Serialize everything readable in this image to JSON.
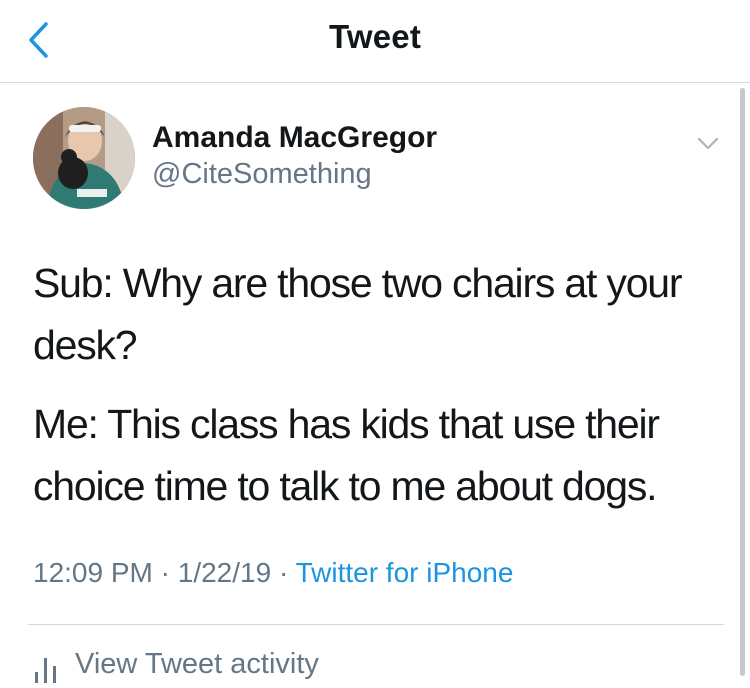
{
  "nav": {
    "title": "Tweet"
  },
  "tweet": {
    "author": {
      "name": "Amanda MacGregor",
      "handle": "@CiteSomething"
    },
    "paragraphs": [
      "Sub: Why are those two chairs at your desk?",
      "Me: This class has kids that use their choice time to talk to me about dogs."
    ],
    "time": "12:09 PM",
    "date": "1/22/19",
    "separator": " · ",
    "source": "Twitter for iPhone"
  },
  "actions": {
    "view_activity": "View Tweet activity"
  },
  "colors": {
    "accent": "#1b95e0",
    "secondary_text": "#657786",
    "primary_text": "#14171a",
    "divider": "#d8d8d8"
  },
  "icons": {
    "back": "chevron-left-icon",
    "menu": "chevron-down-icon",
    "activity": "bar-chart-icon"
  }
}
